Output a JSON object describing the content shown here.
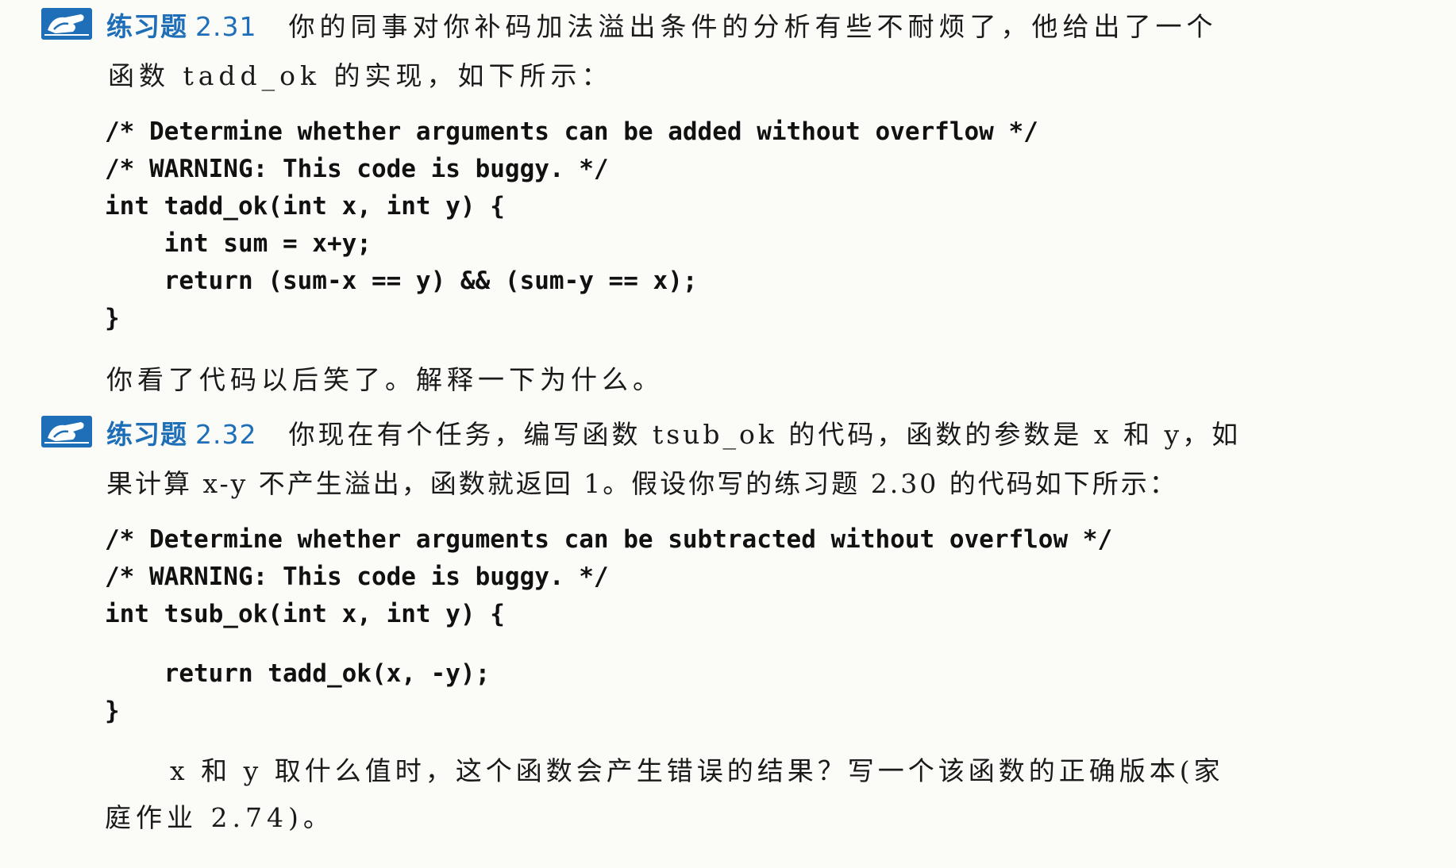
{
  "ex1": {
    "label": "练习题",
    "number": "2.31",
    "line1": "你的同事对你补码加法溢出条件的分析有些不耐烦了，他给出了一个",
    "line2": "函数 tadd_ok 的实现，如下所示：",
    "code": [
      "/* Determine whether arguments can be added without overflow */",
      "/* WARNING: This code is buggy. */",
      "int tadd_ok(int x, int y) {",
      "    int sum = x+y;",
      "    return (sum-x == y) && (sum-y == x);",
      "}"
    ],
    "followup": "你看了代码以后笑了。解释一下为什么。"
  },
  "ex2": {
    "label": "练习题",
    "number": "2.32",
    "line1": "你现在有个任务，编写函数 tsub_ok 的代码，函数的参数是 x 和 y，如",
    "line2": "果计算 x-y 不产生溢出，函数就返回 1。假设你写的练习题 2.30 的代码如下所示：",
    "code": [
      "/* Determine whether arguments can be subtracted without overflow */",
      "/* WARNING: This code is buggy. */",
      "int tsub_ok(int x, int y) {",
      "",
      "    return tadd_ok(x, -y);",
      "}"
    ],
    "followup1": "x 和 y 取什么值时，这个函数会产生错误的结果？写一个该函数的正确版本(家",
    "followup2": "庭作业 2.74)。"
  },
  "icons": {
    "exercise": "pencil-hand-icon"
  },
  "colors": {
    "accent": "#1e6fb8",
    "text": "#1a1a1a",
    "paper": "#fbfbf8"
  }
}
